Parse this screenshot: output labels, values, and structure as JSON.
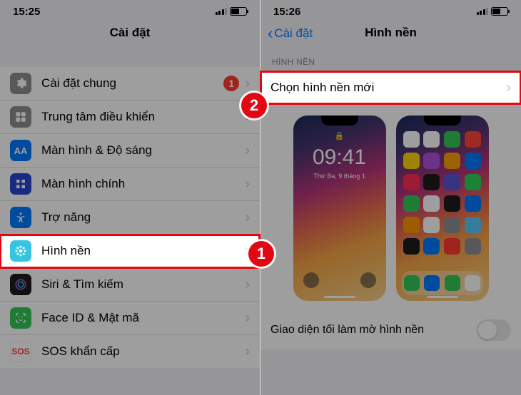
{
  "left": {
    "time": "15:25",
    "title": "Cài đặt",
    "items": {
      "general": {
        "label": "Cài đặt chung",
        "badge": "1"
      },
      "control": {
        "label": "Trung tâm điều khiển"
      },
      "display": {
        "label": "Màn hình & Độ sáng",
        "icon_text": "AA"
      },
      "home": {
        "label": "Màn hình chính"
      },
      "access": {
        "label": "Trợ năng"
      },
      "wallpaper": {
        "label": "Hình nền"
      },
      "siri": {
        "label": "Siri & Tìm kiếm"
      },
      "faceid": {
        "label": "Face ID & Mật mã"
      },
      "sos": {
        "label": "SOS khẩn cấp",
        "icon_text": "SOS"
      }
    }
  },
  "right": {
    "time": "15:26",
    "back": "Cài đặt",
    "title": "Hình nền",
    "section": "HÌNH NỀN",
    "choose": "Chọn hình nền mới",
    "preview": {
      "clock": "09:41",
      "date": "Thứ Ba, 9 tháng 1"
    },
    "dark_label": "Giao diện tối làm mờ hình nền"
  },
  "anno": {
    "one": "1",
    "two": "2"
  }
}
